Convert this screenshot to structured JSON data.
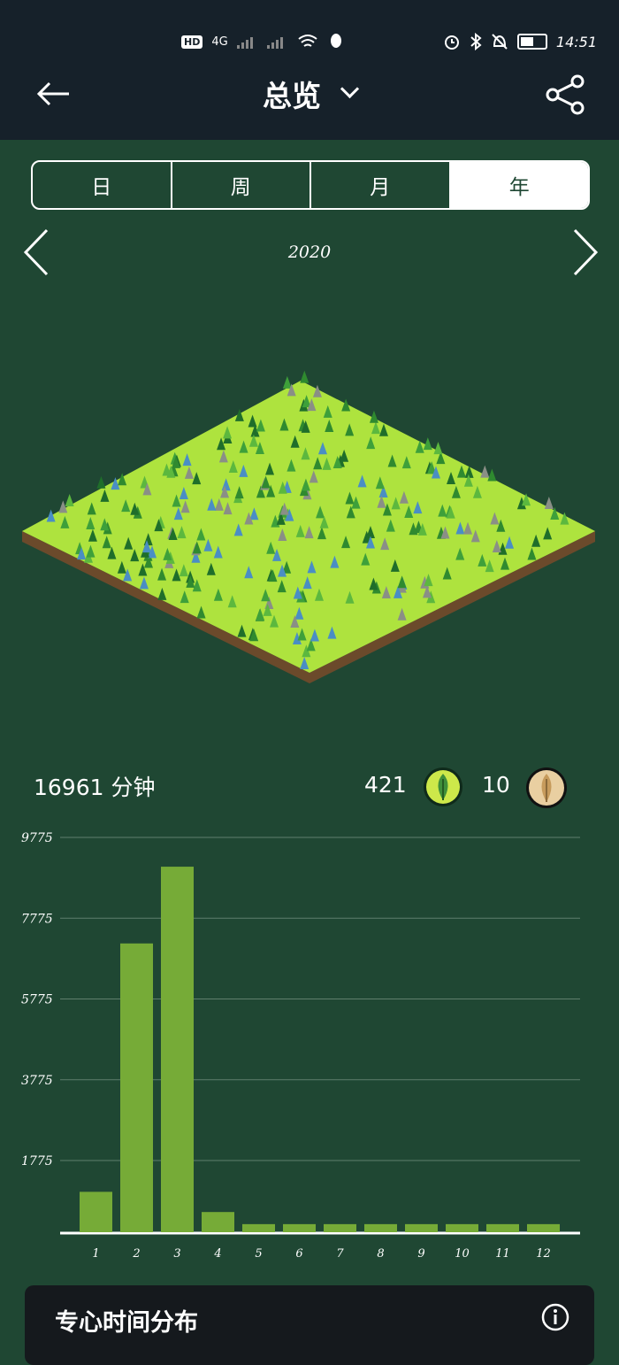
{
  "status": {
    "hd": "HD",
    "sim": "1",
    "network": "4G",
    "time": "14:51"
  },
  "header": {
    "title": "总览",
    "back_icon": "back-arrow-icon",
    "share_icon": "share-icon"
  },
  "tabs": [
    {
      "label": "日",
      "active": false
    },
    {
      "label": "周",
      "active": false
    },
    {
      "label": "月",
      "active": false
    },
    {
      "label": "年",
      "active": true
    }
  ],
  "period": {
    "label": "2020"
  },
  "stats": {
    "minutes": "16961 分钟",
    "live_trees": "421",
    "dead_trees": "10"
  },
  "colors": {
    "background": "#1f4733",
    "header": "#16212a",
    "bar": "#76ab37",
    "grass": "#aee33e"
  },
  "chart_data": {
    "type": "bar",
    "categories": [
      "1",
      "2",
      "3",
      "4",
      "5",
      "6",
      "7",
      "8",
      "9",
      "10",
      "11",
      "12"
    ],
    "values": [
      1000,
      7150,
      9050,
      500,
      200,
      200,
      200,
      200,
      200,
      200,
      200,
      200
    ],
    "yticks": [
      "9775",
      "7775",
      "5775",
      "3775",
      "1775"
    ],
    "ylim": [
      0,
      9775
    ],
    "grid": true
  },
  "card": {
    "title": "专心时间分布",
    "info_icon": "info-icon"
  }
}
